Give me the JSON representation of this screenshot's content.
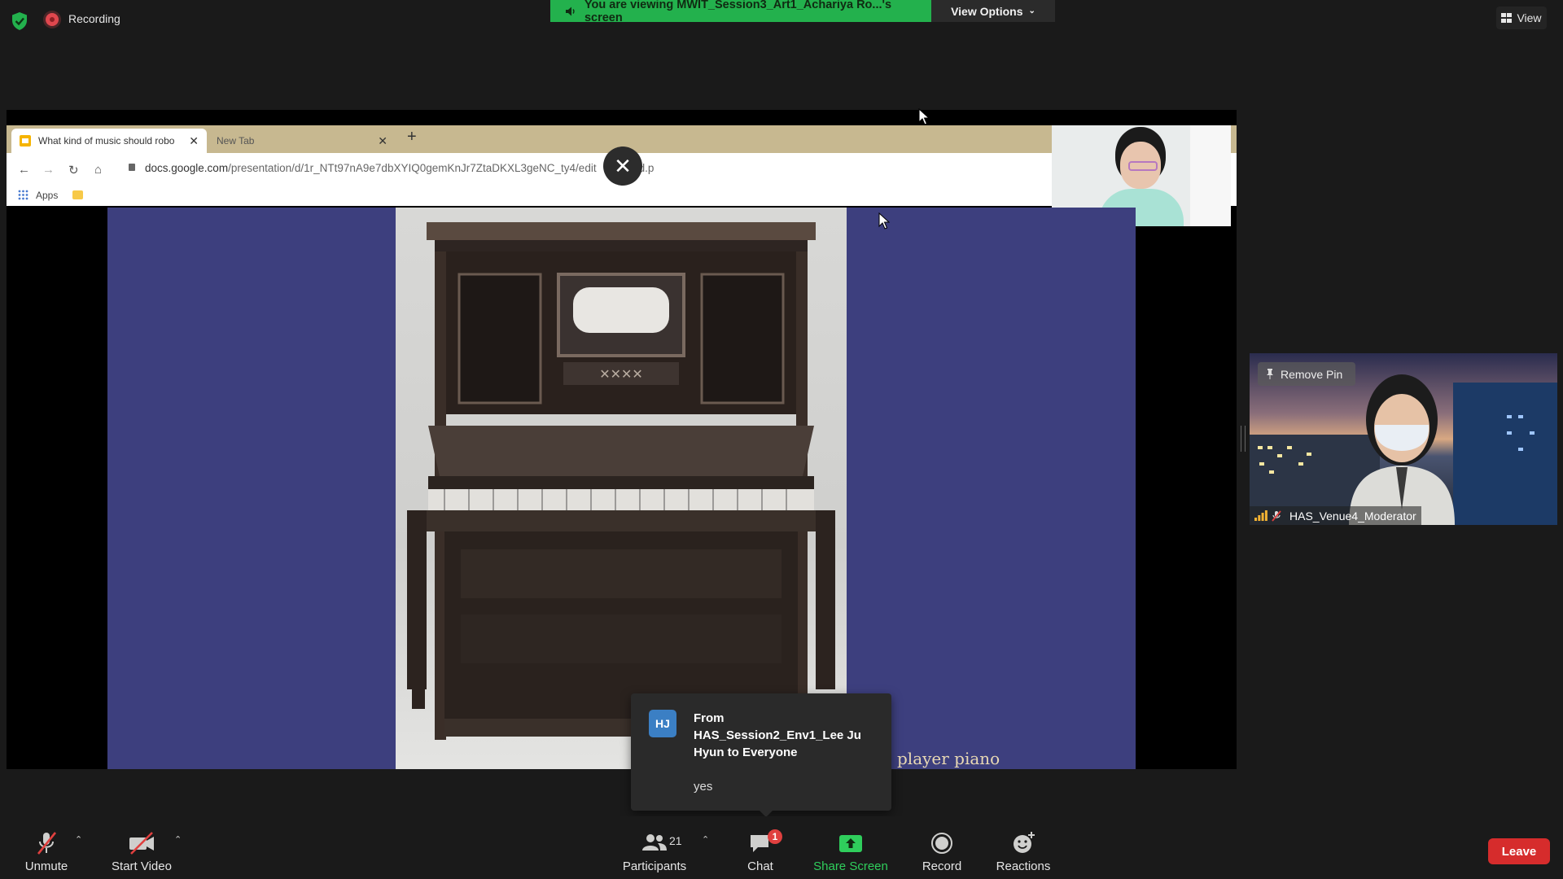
{
  "top_bar": {
    "recording_label": "Recording",
    "banner_text": "You are viewing MWIT_Session3_Art1_Achariya Ro...'s screen",
    "view_options_label": "View Options",
    "view_label": "View"
  },
  "shared_browser": {
    "tabs": [
      {
        "label": "What kind of music should robo"
      },
      {
        "label": "New Tab"
      }
    ],
    "url_host": "docs.google.com",
    "url_path_a": "/presentation/d/1r_NTt97nA9e7dbXYIQ0gemKnJr7ZtaDKXL3geNC_ty4/edit",
    "url_path_b": "d.p",
    "bookmarks_apps": "Apps"
  },
  "slide": {
    "caption": "player piano"
  },
  "pinned_video": {
    "remove_pin_label": "Remove Pin",
    "participant_name": "HAS_Venue4_Moderator"
  },
  "chat_notification": {
    "avatar_initials": "HJ",
    "from_text": "From HAS_Session2_Env1_Lee Ju Hyun to Everyone",
    "message": "yes"
  },
  "toolbar": {
    "unmute": "Unmute",
    "start_video": "Start Video",
    "participants": "Participants",
    "participants_count": "21",
    "chat": "Chat",
    "chat_badge": "1",
    "share_screen": "Share Screen",
    "record": "Record",
    "reactions": "Reactions",
    "leave": "Leave"
  },
  "colors": {
    "banner_green": "#23b14d",
    "slide_blue": "#3d3f7e",
    "leave_red": "#d62c2c",
    "share_green": "#2fce5c"
  }
}
